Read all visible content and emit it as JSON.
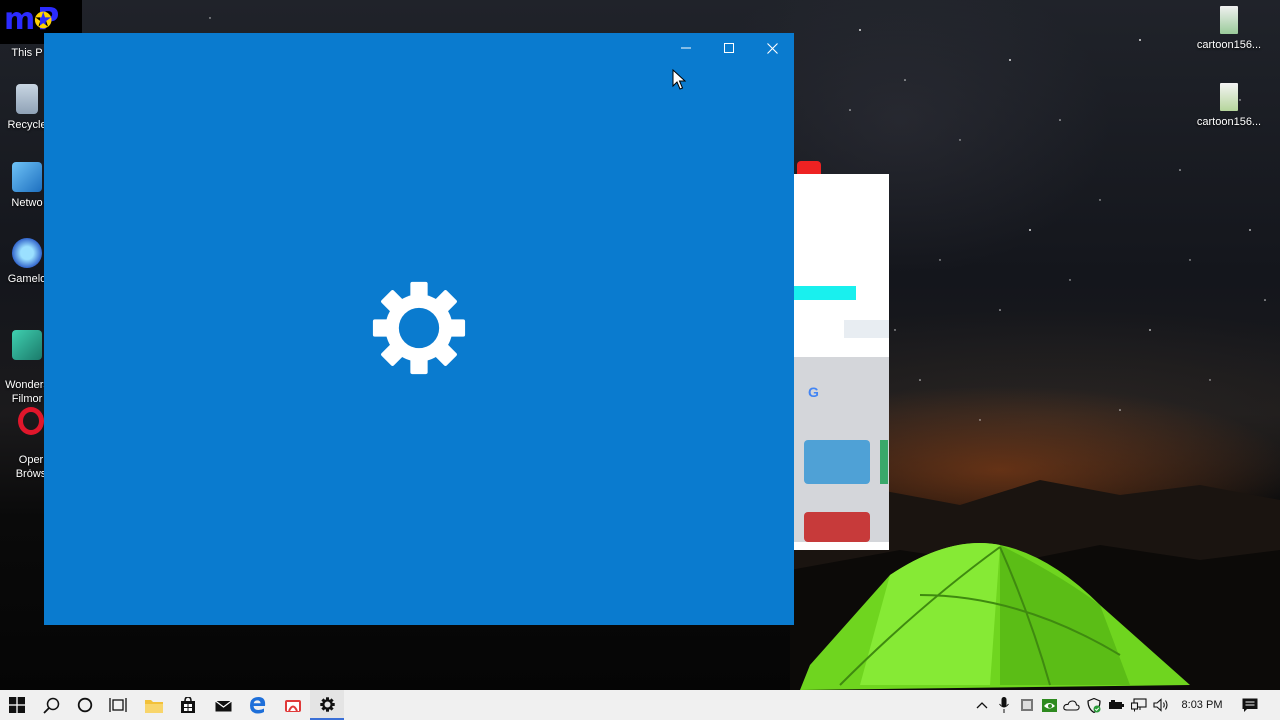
{
  "desktop": {
    "icons_left": [
      {
        "label": "This P",
        "icon": "this-pc-icon"
      },
      {
        "label": "Recycle",
        "icon": "recycle-bin-icon"
      },
      {
        "label": "Netwo",
        "icon": "network-icon"
      },
      {
        "label": "Gamelo",
        "icon": "gameloop-icon"
      },
      {
        "label": "Wonders\nFilmor",
        "icon": "filmora-icon"
      },
      {
        "label": "Oper\nBrows",
        "icon": "opera-icon"
      }
    ],
    "icons_right": [
      {
        "label": "cartoon156...",
        "icon": "image-file-icon"
      },
      {
        "label": "cartoon156...",
        "icon": "image-file-icon"
      }
    ]
  },
  "logo": {
    "text": "mP"
  },
  "settings_window": {
    "background": "#0a7bcf",
    "splash_icon": "gear-icon",
    "caption_buttons": [
      "minimize",
      "maximize",
      "close"
    ]
  },
  "taskbar": {
    "pinned": [
      "start",
      "search",
      "cortana",
      "task-view",
      "file-explorer",
      "store",
      "mail",
      "edge",
      "opera",
      "settings"
    ],
    "active": "settings",
    "clock": "8:03 PM"
  },
  "colors": {
    "accent": "#0a7bcf",
    "taskbar": "#f0f0f0",
    "tent": "#7fe02a"
  }
}
